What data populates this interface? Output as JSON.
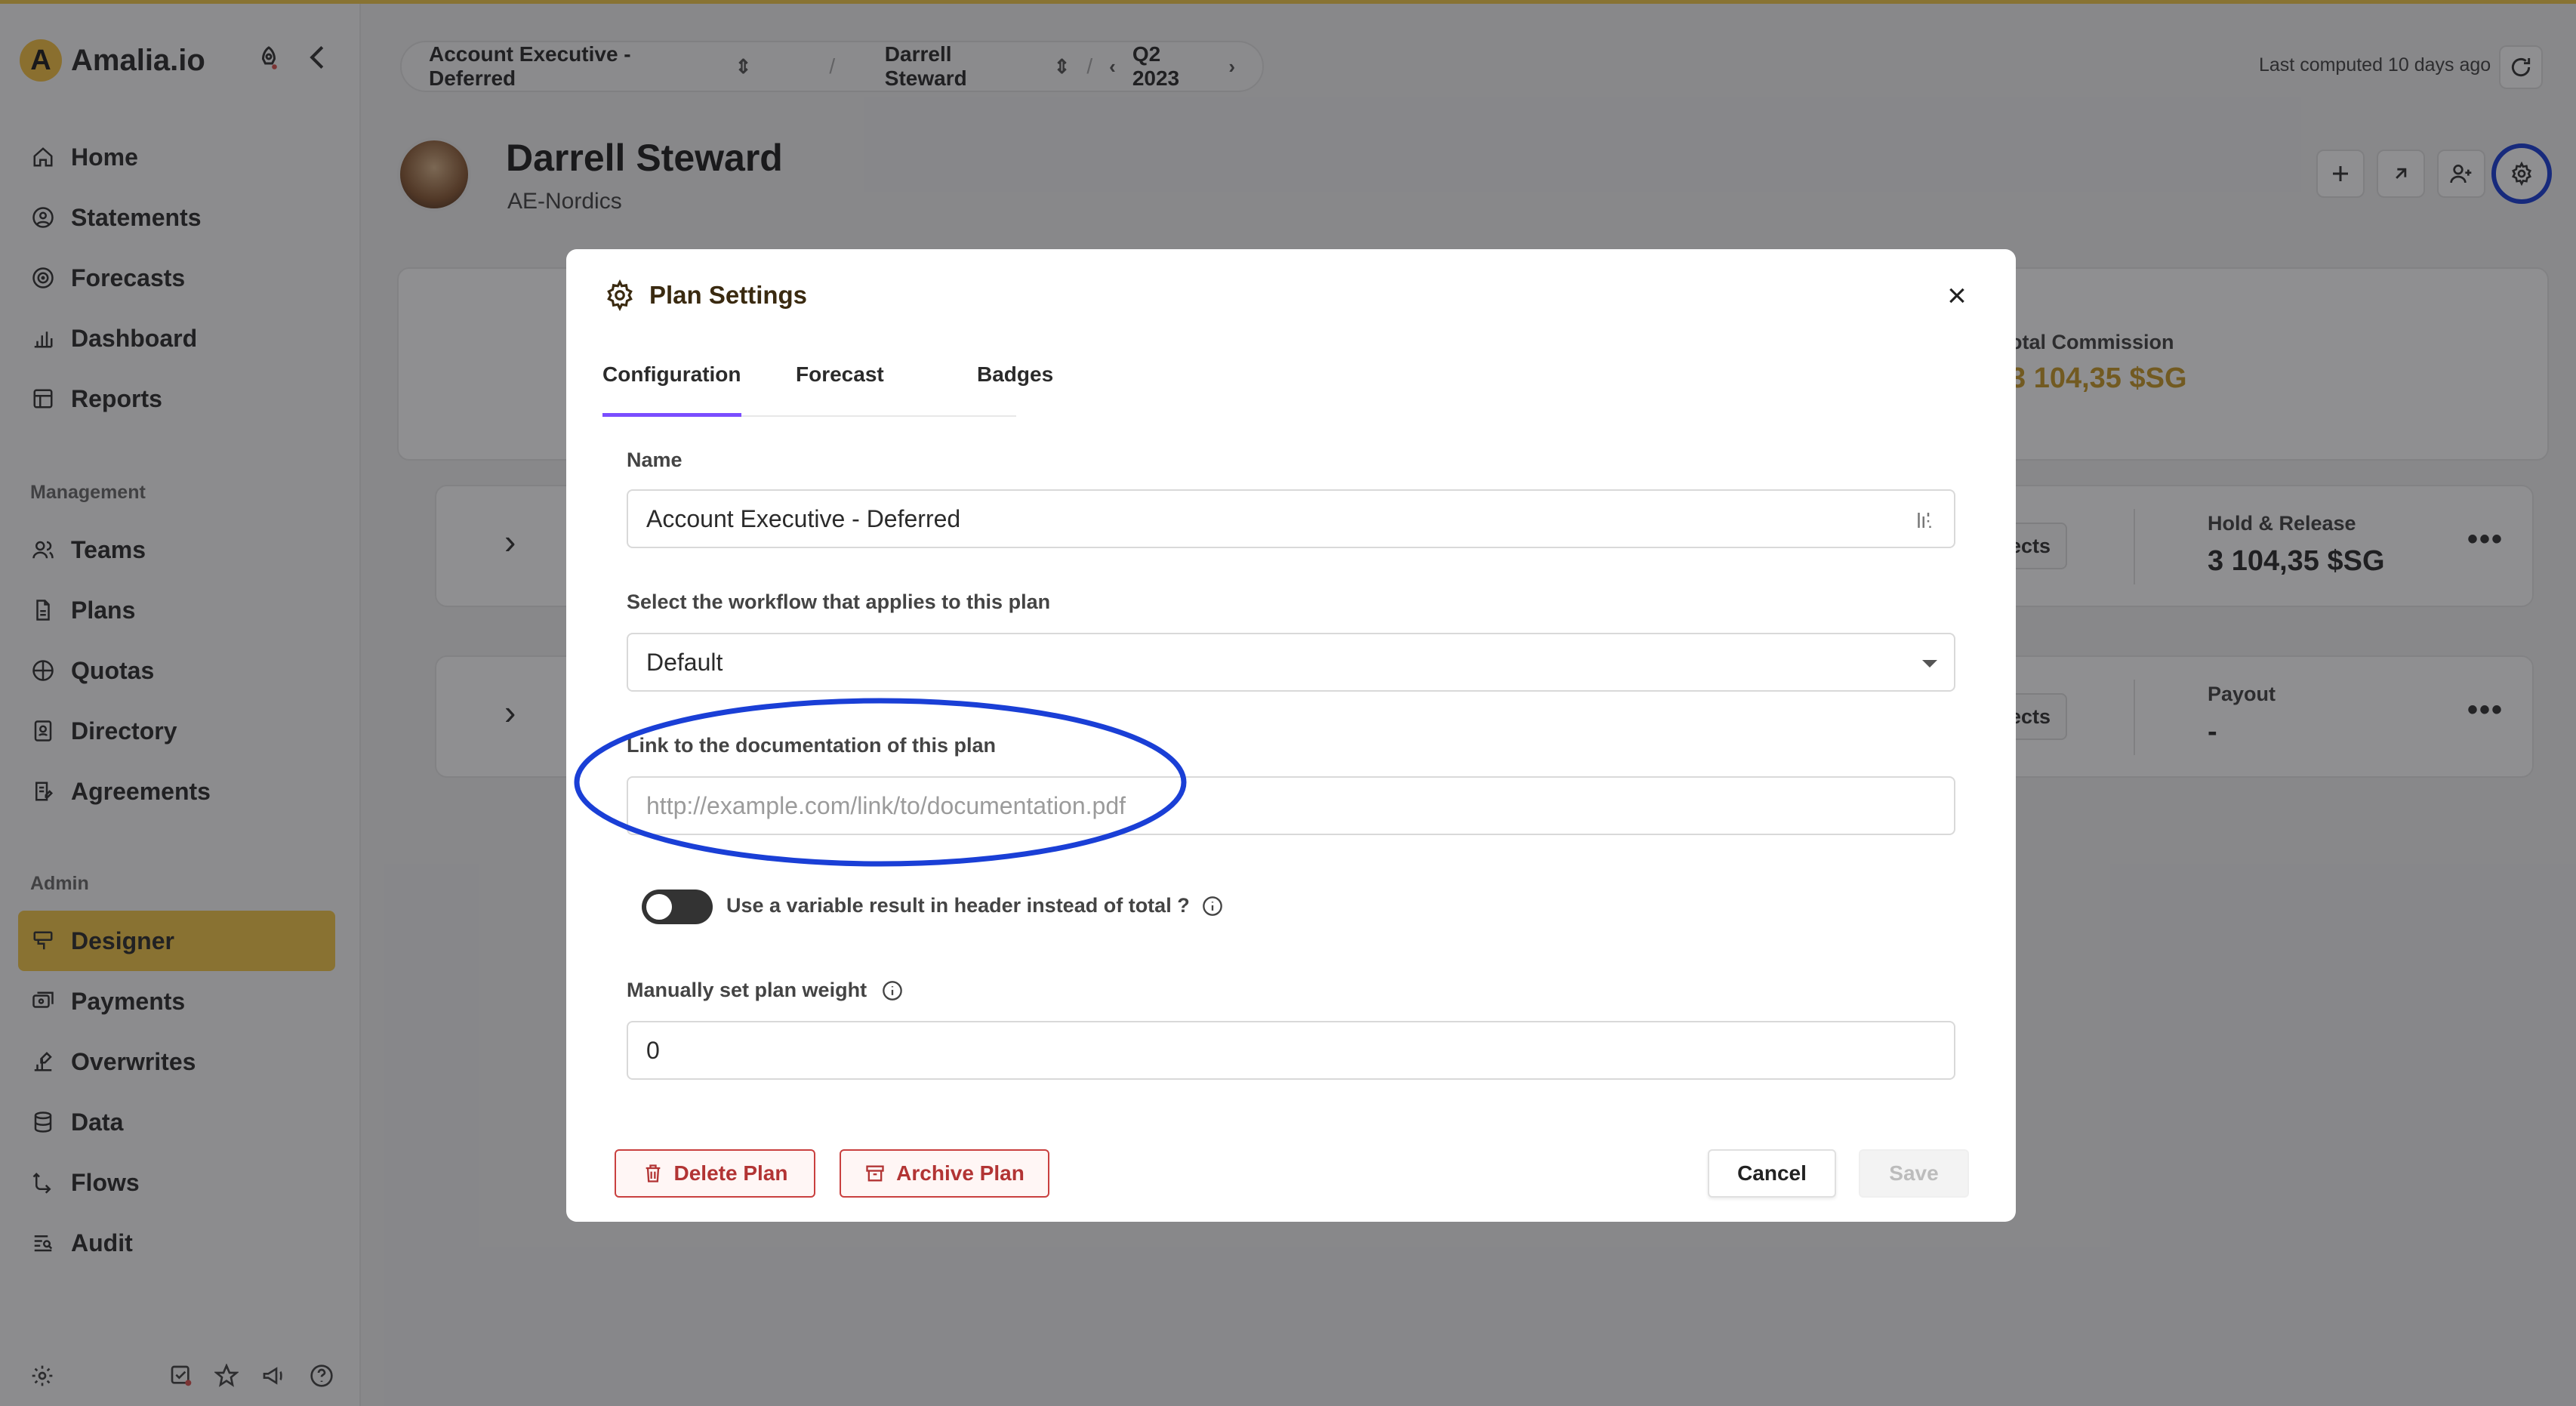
{
  "app": {
    "logo_letter": "A",
    "logo_text": "Amalia.io"
  },
  "sidebar": {
    "main_items": [
      {
        "label": "Home",
        "icon": "home-icon"
      },
      {
        "label": "Statements",
        "icon": "user-circle-icon"
      },
      {
        "label": "Forecasts",
        "icon": "forecast-icon"
      },
      {
        "label": "Dashboard",
        "icon": "bar-chart-icon"
      },
      {
        "label": "Reports",
        "icon": "table-icon"
      }
    ],
    "management_label": "Management",
    "management_items": [
      {
        "label": "Teams",
        "icon": "users-icon"
      },
      {
        "label": "Plans",
        "icon": "file-icon"
      },
      {
        "label": "Quotas",
        "icon": "target-icon"
      },
      {
        "label": "Directory",
        "icon": "address-book-icon"
      },
      {
        "label": "Agreements",
        "icon": "agreement-icon"
      }
    ],
    "admin_label": "Admin",
    "admin_items": [
      {
        "label": "Designer",
        "icon": "designer-icon",
        "active": true
      },
      {
        "label": "Payments",
        "icon": "payments-icon"
      },
      {
        "label": "Overwrites",
        "icon": "overwrite-icon"
      },
      {
        "label": "Data",
        "icon": "database-icon"
      },
      {
        "label": "Flows",
        "icon": "flow-icon"
      },
      {
        "label": "Audit",
        "icon": "audit-icon"
      }
    ]
  },
  "header": {
    "plan": "Account Executive - Deferred",
    "sep": "/",
    "person": "Darrell Steward",
    "period": "Q2 2023",
    "last_computed": "Last computed 10 days ago"
  },
  "profile": {
    "name": "Darrell Steward",
    "team": "AE-Nordics"
  },
  "cards": {
    "total_commission_label": "otal Commission",
    "total_commission_value": "3 104,35 $SG",
    "objects_label": "bjects",
    "hold_release_label": "Hold & Release",
    "hold_release_value": "3 104,35 $SG",
    "payout_label": "Payout",
    "payout_value": "-",
    "dots": "•••"
  },
  "modal": {
    "title": "Plan Settings",
    "close": "×",
    "tabs": [
      "Configuration",
      "Forecast",
      "Badges"
    ],
    "name_label": "Name",
    "name_value": "Account Executive - Deferred",
    "workflow_label": "Select the workflow that applies to this plan",
    "workflow_value": "Default",
    "doc_label": "Link to the documentation of this plan",
    "doc_placeholder": "http://example.com/link/to/documentation.pdf",
    "toggle_label": "Use a variable result in header instead of total ?",
    "weight_label": "Manually set plan weight",
    "weight_value": "0",
    "delete_label": "Delete Plan",
    "archive_label": "Archive Plan",
    "cancel_label": "Cancel",
    "save_label": "Save"
  },
  "colors": {
    "accent": "#f3c74a",
    "tab_underline": "#7a4dff",
    "highlight": "#1a3fd6",
    "danger": "#c9403f"
  }
}
